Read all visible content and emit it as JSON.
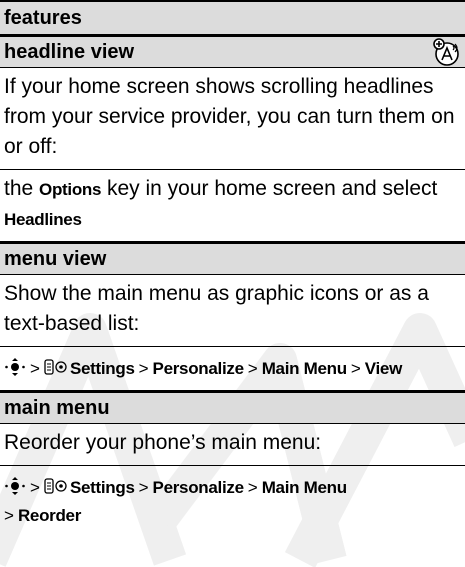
{
  "header": {
    "title": "features"
  },
  "sections": [
    {
      "title": "headline view",
      "icon": "network-feature-icon",
      "description": "If your home screen shows scrolling headlines from your service provider, you can turn them on or off:",
      "instruction": {
        "prefix": "the ",
        "key": "Options",
        "middle": " key in your home screen and select ",
        "item": "Headlines"
      }
    },
    {
      "title": "menu view",
      "description": "Show the main menu as graphic icons or as a text-based list:",
      "path": {
        "nav_icon": "nav-key-icon",
        "settings_icon": "settings-icon",
        "steps": [
          "Settings",
          "Personalize",
          "Main Menu",
          "View"
        ]
      }
    },
    {
      "title": "main menu",
      "description": "Reorder your phone’s main menu:",
      "path": {
        "nav_icon": "nav-key-icon",
        "settings_icon": "settings-icon",
        "steps": [
          "Settings",
          "Personalize",
          "Main Menu",
          "Reorder"
        ]
      }
    }
  ],
  "separator": ">",
  "colors": {
    "header_bg": "#dcdcdc",
    "border": "#000000",
    "watermark": "#eeeeee"
  }
}
